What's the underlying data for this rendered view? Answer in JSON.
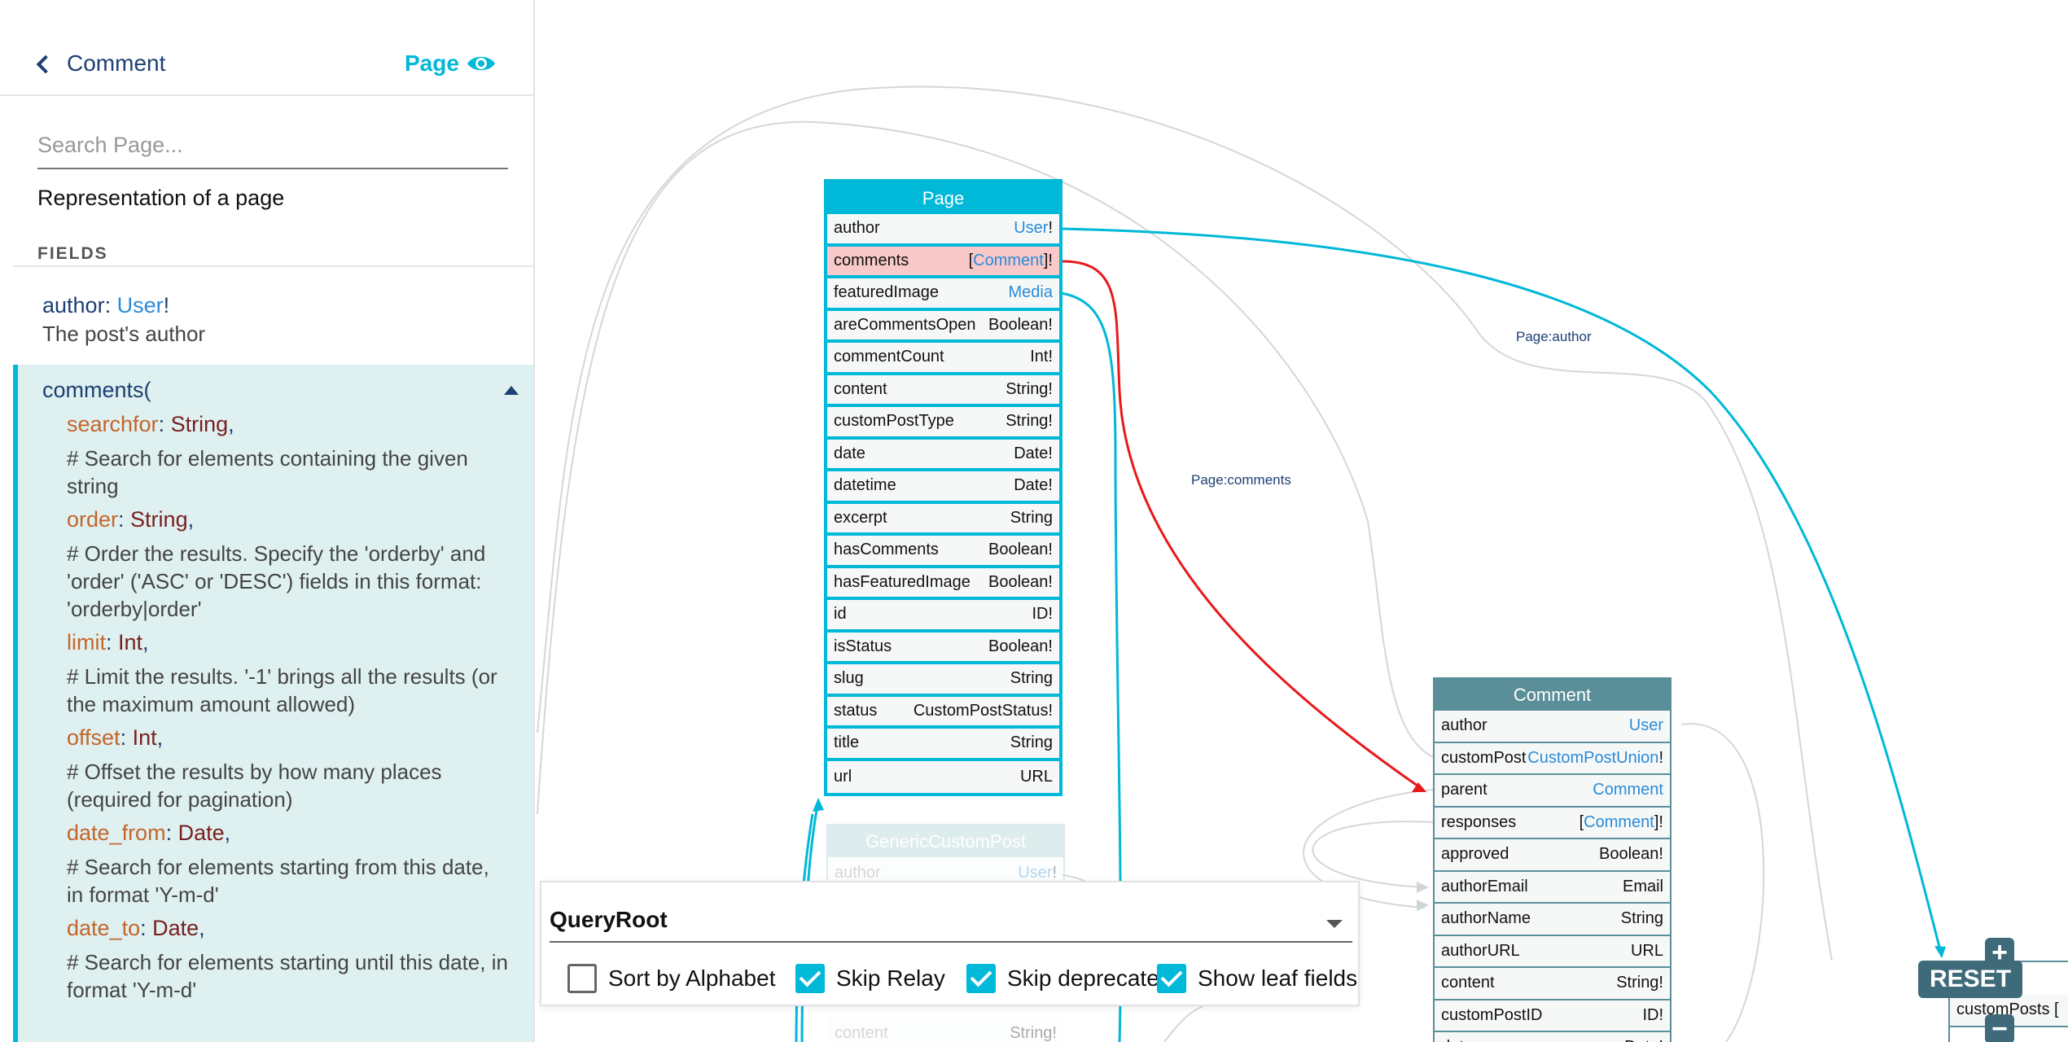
{
  "sidebar": {
    "back_label": "Comment",
    "current_type": "Page",
    "search_placeholder": "Search Page...",
    "type_description": "Representation of a page",
    "fields_heading": "FIELDS",
    "field_author": {
      "name": "author",
      "type": "User",
      "suffix": "!",
      "description": "The post's author"
    },
    "field_comments": {
      "name": "comments(",
      "args": [
        {
          "name": "searchfor",
          "type": "String",
          "comment": "# Search for elements containing the given string"
        },
        {
          "name": "order",
          "type": "String",
          "comment": "# Order the results. Specify the 'orderby' and 'order' ('ASC' or 'DESC') fields in this format: 'orderby|order'"
        },
        {
          "name": "limit",
          "type": "Int",
          "comment": "# Limit the results. '-1' brings all the results (or the maximum amount allowed)"
        },
        {
          "name": "offset",
          "type": "Int",
          "comment": "# Offset the results by how many places (required for pagination)"
        },
        {
          "name": "date_from",
          "type": "Date",
          "comment": "# Search for elements starting from this date, in format 'Y-m-d'"
        },
        {
          "name": "date_to",
          "type": "Date",
          "comment": "# Search for elements starting until this date, in format 'Y-m-d'"
        }
      ]
    }
  },
  "graph": {
    "page_node": {
      "title": "Page",
      "fields": [
        {
          "name": "author",
          "type_pre": "",
          "type_link": "User",
          "type_post": "!"
        },
        {
          "name": "comments",
          "type_pre": "[",
          "type_link": "Comment",
          "type_post": "]!"
        },
        {
          "name": "featuredImage",
          "type_pre": "",
          "type_link": "Media",
          "type_post": ""
        },
        {
          "name": "areCommentsOpen",
          "type_pre": "Boolean!",
          "type_link": "",
          "type_post": ""
        },
        {
          "name": "commentCount",
          "type_pre": "Int!",
          "type_link": "",
          "type_post": ""
        },
        {
          "name": "content",
          "type_pre": "String!",
          "type_link": "",
          "type_post": ""
        },
        {
          "name": "customPostType",
          "type_pre": "String!",
          "type_link": "",
          "type_post": ""
        },
        {
          "name": "date",
          "type_pre": "Date!",
          "type_link": "",
          "type_post": ""
        },
        {
          "name": "datetime",
          "type_pre": "Date!",
          "type_link": "",
          "type_post": ""
        },
        {
          "name": "excerpt",
          "type_pre": "String",
          "type_link": "",
          "type_post": ""
        },
        {
          "name": "hasComments",
          "type_pre": "Boolean!",
          "type_link": "",
          "type_post": ""
        },
        {
          "name": "hasFeaturedImage",
          "type_pre": "Boolean!",
          "type_link": "",
          "type_post": ""
        },
        {
          "name": "id",
          "type_pre": "ID!",
          "type_link": "",
          "type_post": ""
        },
        {
          "name": "isStatus",
          "type_pre": "Boolean!",
          "type_link": "",
          "type_post": ""
        },
        {
          "name": "slug",
          "type_pre": "String",
          "type_link": "",
          "type_post": ""
        },
        {
          "name": "status",
          "type_pre": "CustomPostStatus!",
          "type_link": "",
          "type_post": ""
        },
        {
          "name": "title",
          "type_pre": "String",
          "type_link": "",
          "type_post": ""
        },
        {
          "name": "url",
          "type_pre": "URL",
          "type_link": "",
          "type_post": ""
        }
      ]
    },
    "comment_node": {
      "title": "Comment",
      "fields": [
        {
          "name": "author",
          "type_pre": "",
          "type_link": "User",
          "type_post": ""
        },
        {
          "name": "customPost",
          "type_pre": "",
          "type_link": "CustomPostUnion",
          "type_post": "!"
        },
        {
          "name": "parent",
          "type_pre": "",
          "type_link": "Comment",
          "type_post": ""
        },
        {
          "name": "responses",
          "type_pre": "[",
          "type_link": "Comment",
          "type_post": "]!"
        },
        {
          "name": "approved",
          "type_pre": "Boolean!",
          "type_link": "",
          "type_post": ""
        },
        {
          "name": "authorEmail",
          "type_pre": "Email",
          "type_link": "",
          "type_post": ""
        },
        {
          "name": "authorName",
          "type_pre": "String",
          "type_link": "",
          "type_post": ""
        },
        {
          "name": "authorURL",
          "type_pre": "URL",
          "type_link": "",
          "type_post": ""
        },
        {
          "name": "content",
          "type_pre": "String!",
          "type_link": "",
          "type_post": ""
        },
        {
          "name": "customPostID",
          "type_pre": "ID!",
          "type_link": "",
          "type_post": ""
        },
        {
          "name": "date",
          "type_pre": "Date!",
          "type_link": "",
          "type_post": ""
        }
      ]
    },
    "generic_node": {
      "title": "GenericCustomPost",
      "fields": [
        {
          "name": "author",
          "type_pre": "",
          "type_link": "User",
          "type_post": "!"
        },
        {
          "name": "content",
          "type_pre": "String!",
          "type_link": "",
          "type_post": ""
        }
      ]
    },
    "user_node_partial": {
      "field": "customPosts ["
    },
    "edge_labels": {
      "page_author": "Page:author",
      "page_comments": "Page:comments"
    }
  },
  "zoom": {
    "zoom_in": "+",
    "zoom_out": "−",
    "reset": "RESET"
  },
  "root_panel": {
    "selected_root": "QueryRoot",
    "options": [
      {
        "label": "Sort by Alphabet",
        "checked": false
      },
      {
        "label": "Skip Relay",
        "checked": true
      },
      {
        "label": "Skip deprecated",
        "checked": true
      },
      {
        "label": "Show leaf fields",
        "checked": true
      }
    ]
  },
  "colors": {
    "accent": "#00b8d8",
    "highlight_edge": "#e8191b",
    "comment_header": "#5a8f99",
    "link": "#2a8bd9",
    "navy": "#1d3f73"
  }
}
